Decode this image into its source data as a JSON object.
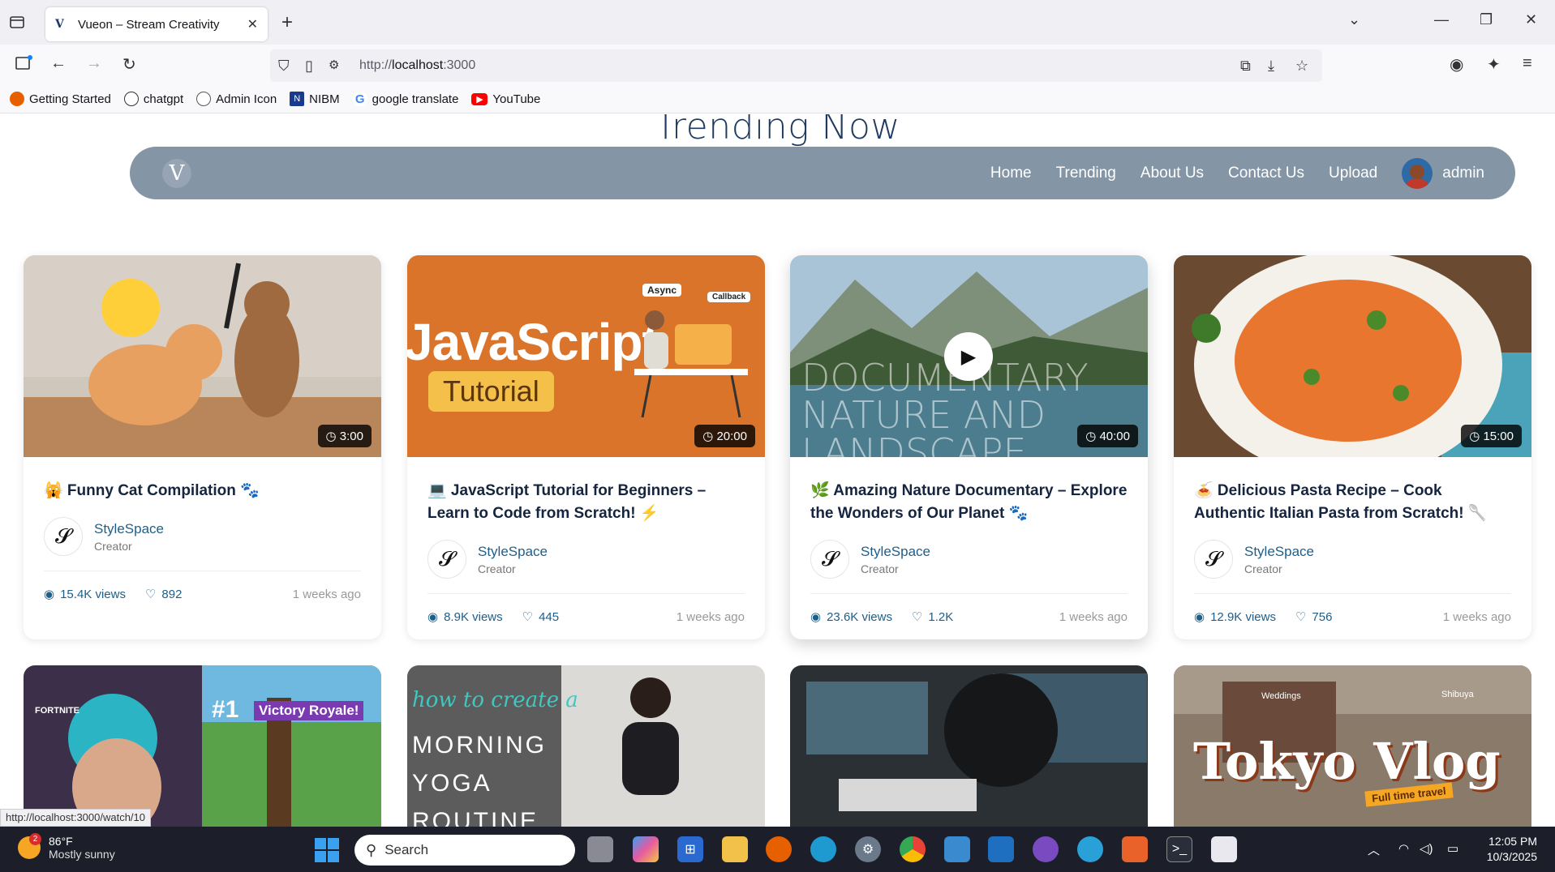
{
  "browser": {
    "tab_title": "Vueon – Stream Creativity",
    "tab_favicon": "V",
    "url_host": "localhost",
    "url_prefix": "http://",
    "url_suffix": ":3000",
    "status_url": "http://localhost:3000/watch/10",
    "bookmarks": [
      {
        "label": "Getting Started",
        "icon": "firefox-icon",
        "color": "#e66000"
      },
      {
        "label": "chatgpt",
        "icon": "chatgpt-icon",
        "color": "#333333"
      },
      {
        "label": "Admin Icon",
        "icon": "globe-icon",
        "color": "#555555"
      },
      {
        "label": "NIBM",
        "icon": "nibm-icon",
        "color": "#1a3a8e"
      },
      {
        "label": "google translate",
        "icon": "google-icon",
        "color": "#4285f4"
      },
      {
        "label": "YouTube",
        "icon": "youtube-icon",
        "color": "#ff0000"
      }
    ]
  },
  "page": {
    "heading": "Trending Now",
    "logo": "V",
    "nav": [
      "Home",
      "Trending",
      "About Us",
      "Contact Us",
      "Upload"
    ],
    "user": "admin"
  },
  "videos": [
    {
      "title": "🙀 Funny Cat Compilation 🐾",
      "duration": "3:00",
      "creator": "StyleSpace",
      "role": "Creator",
      "views": "15.4K views",
      "likes": "892",
      "ago": "1 weeks ago"
    },
    {
      "title": "💻 JavaScript Tutorial for Beginners – Learn to Code from Scratch! ⚡",
      "duration": "20:00",
      "creator": "StyleSpace",
      "role": "Creator",
      "views": "8.9K views",
      "likes": "445",
      "ago": "1 weeks ago",
      "thumb_text": "JavaScript",
      "thumb_sub": "Tutorial",
      "thumb_tag1": "Async",
      "thumb_tag2": "Callback"
    },
    {
      "title": "🌿 Amazing Nature Documentary – Explore the Wonders of Our Planet 🐾",
      "duration": "40:00",
      "creator": "StyleSpace",
      "role": "Creator",
      "views": "23.6K views",
      "likes": "1.2K",
      "ago": "1 weeks ago",
      "thumb_text": "DOCUMENTARY NATURE AND LANDSCAPE"
    },
    {
      "title": "🍝 Delicious Pasta Recipe – Cook Authentic Italian Pasta from Scratch! 🥄",
      "duration": "15:00",
      "creator": "StyleSpace",
      "role": "Creator",
      "views": "12.9K views",
      "likes": "756",
      "ago": "1 weeks ago"
    }
  ],
  "second_row": [
    {
      "thumb_text": "Victory Royale!",
      "thumb_sub": "#1",
      "side_text": "FORTNITE"
    },
    {
      "thumb_text": "how to create a",
      "thumb_sub": "MORNING YOGA ROUTINE"
    },
    {
      "thumb_text": ""
    },
    {
      "thumb_text": "Tokyo Vlog",
      "thumb_sub": "Full time travel",
      "tag1": "Weddings",
      "tag2": "Shibuya"
    }
  ],
  "taskbar": {
    "temp": "86°F",
    "condition": "Mostly sunny",
    "weather_badge": "2",
    "search": "Search",
    "time": "12:05 PM",
    "date": "10/3/2025"
  },
  "colors": {
    "header_bg": "#6e8296",
    "link": "#1d5f8a",
    "title": "#15253f"
  }
}
